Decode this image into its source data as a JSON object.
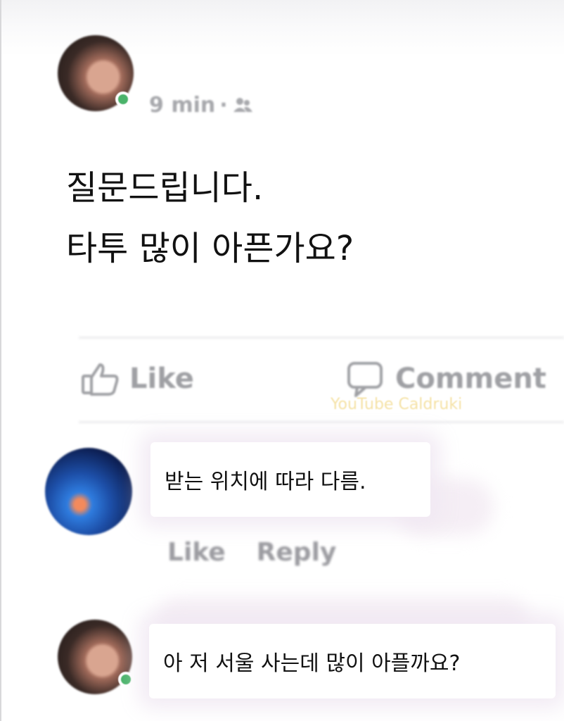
{
  "post": {
    "time": "9 min",
    "separator": "·",
    "audience_icon": "friends-icon",
    "text_line_1": "질문드립니다.",
    "text_line_2": "타투 많이 아픈가요?"
  },
  "actions": {
    "like_label": "Like",
    "comment_label": "Comment"
  },
  "watermark": "YouTube Caldruki",
  "comments": [
    {
      "avatar": "xray-avatar",
      "text": "받는 위치에 따라 다름.",
      "like_label": "Like",
      "reply_label": "Reply"
    },
    {
      "avatar": "person-avatar",
      "text": "아 저 서울 사는데 많이 아플까요?"
    }
  ],
  "colors": {
    "online": "#4ab36a",
    "muted_text": "#a7a8ac",
    "body_text": "#111111"
  }
}
